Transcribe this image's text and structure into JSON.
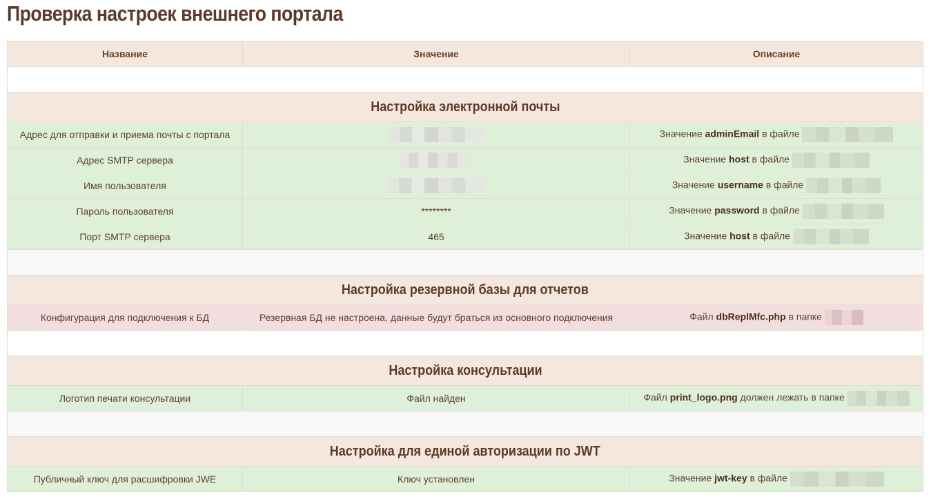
{
  "page": {
    "title": "Проверка настроек внешнего портала"
  },
  "table": {
    "headers": [
      "Название",
      "Значение",
      "Описание"
    ]
  },
  "sections": {
    "email": {
      "title": "Настройка электронной почты",
      "rows": [
        {
          "name": "Адрес для отправки и приема почты с портала",
          "desc_prefix": "Значение ",
          "desc_key": "adminEmail",
          "desc_suffix": " в файле"
        },
        {
          "name": "Адрес SMTP сервера",
          "desc_prefix": "Значение ",
          "desc_key": "host",
          "desc_suffix": " в файле"
        },
        {
          "name": "Имя пользователя",
          "desc_prefix": "Значение ",
          "desc_key": "username",
          "desc_suffix": " в файле"
        },
        {
          "name": "Пароль пользователя",
          "value": "********",
          "desc_prefix": "Значение ",
          "desc_key": "password",
          "desc_suffix": " в файле"
        },
        {
          "name": "Порт SMTP сервера",
          "value": "465",
          "desc_prefix": "Значение ",
          "desc_key": "host",
          "desc_suffix": " в файле"
        }
      ]
    },
    "backup_db": {
      "title": "Настройка резервной базы для отчетов",
      "rows": [
        {
          "name": "Конфигурация для подключения к БД",
          "value": "Резервная БД не настроена, данные будут браться из основного подключения",
          "desc_prefix": "Файл ",
          "desc_key": "dbReplMfc.php",
          "desc_suffix": " в папке"
        }
      ]
    },
    "consultation": {
      "title": "Настройка консультации",
      "rows": [
        {
          "name": "Логотип печати консультации",
          "value": "Файл найден",
          "desc_prefix": "Файл ",
          "desc_key": "print_logo.png",
          "desc_suffix": " должен лежать в папке"
        }
      ]
    },
    "jwt": {
      "title": "Настройка для единой авторизации по JWT",
      "rows": [
        {
          "name": "Публичный ключ для расшифровки JWE",
          "value": "Ключ установлен",
          "desc_prefix": "Значение ",
          "desc_key": "jwt-key",
          "desc_suffix": " в файле"
        }
      ]
    }
  },
  "colors": {
    "header_bg": "#f4e7dd",
    "ok_row_bg": "#dff0d8",
    "error_row_bg": "#f2dede",
    "text": "#5b3a28"
  }
}
